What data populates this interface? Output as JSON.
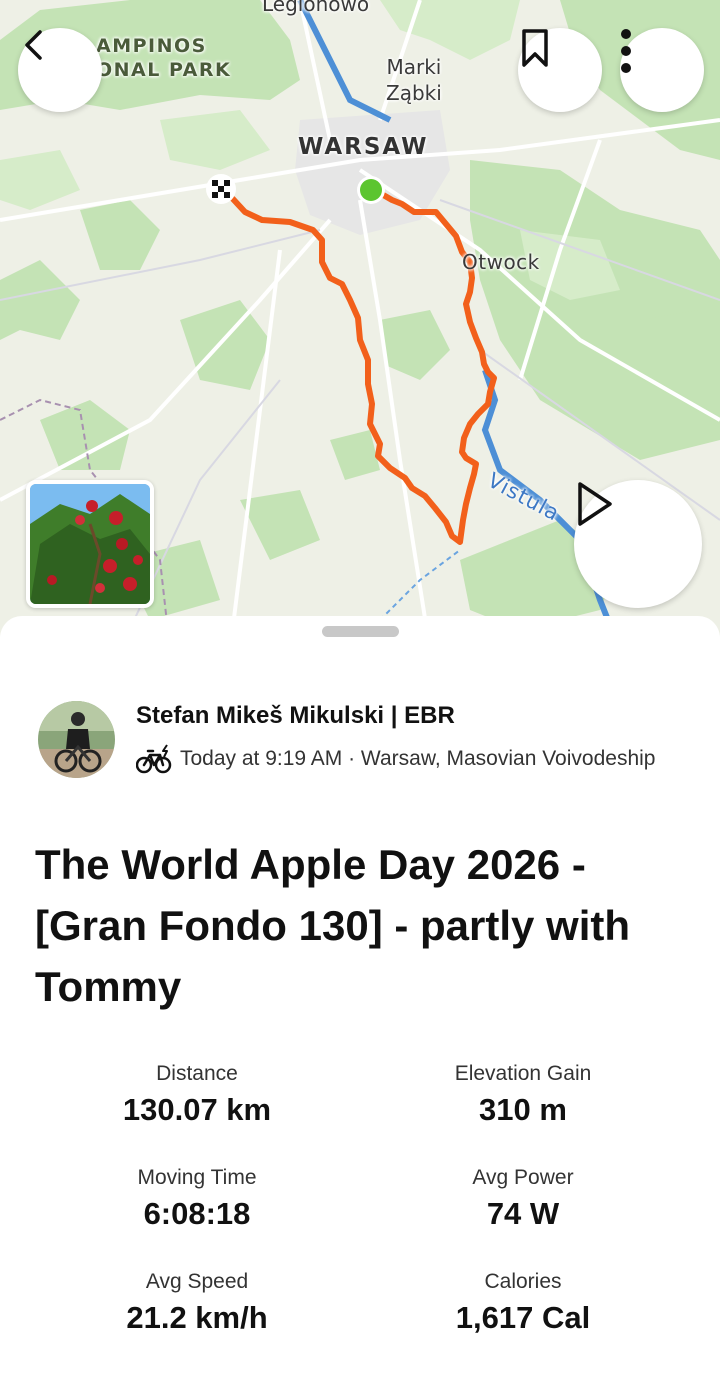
{
  "map": {
    "labels": {
      "legionowo": "Legionowo",
      "park_line1": "AMPINOS",
      "park_line2": "ONAL PARK",
      "marki": "Marki",
      "zabki": "Ząbki",
      "warsaw": "WARSAW",
      "otwock": "Otwock",
      "vistula": "Vistula"
    },
    "colors": {
      "route": "#f2601b",
      "start_marker": "#5cc52f",
      "river": "#4d8fd6",
      "forest": "#bfe0b0"
    }
  },
  "icons": {
    "back": "chevron-left-icon",
    "bookmark": "bookmark-icon",
    "more": "more-vertical-icon",
    "play": "play-icon",
    "activity_type": "e-bike-icon",
    "finish": "checkered-flag-icon"
  },
  "activity": {
    "athlete_name": "Stefan  Mikeš Mikulski | EBR",
    "meta": "Today at 9:19 AM · Warsaw, Masovian Voivodeship",
    "title": "The World Apple Day 2026 - [Gran Fondo 130] - partly with Tommy"
  },
  "stats": [
    {
      "label": "Distance",
      "value": "130.07 km"
    },
    {
      "label": "Elevation Gain",
      "value": "310 m"
    },
    {
      "label": "Moving Time",
      "value": "6:08:18"
    },
    {
      "label": "Avg Power",
      "value": "74 W"
    },
    {
      "label": "Avg Speed",
      "value": "21.2 km/h"
    },
    {
      "label": "Calories",
      "value": "1,617 Cal"
    }
  ]
}
